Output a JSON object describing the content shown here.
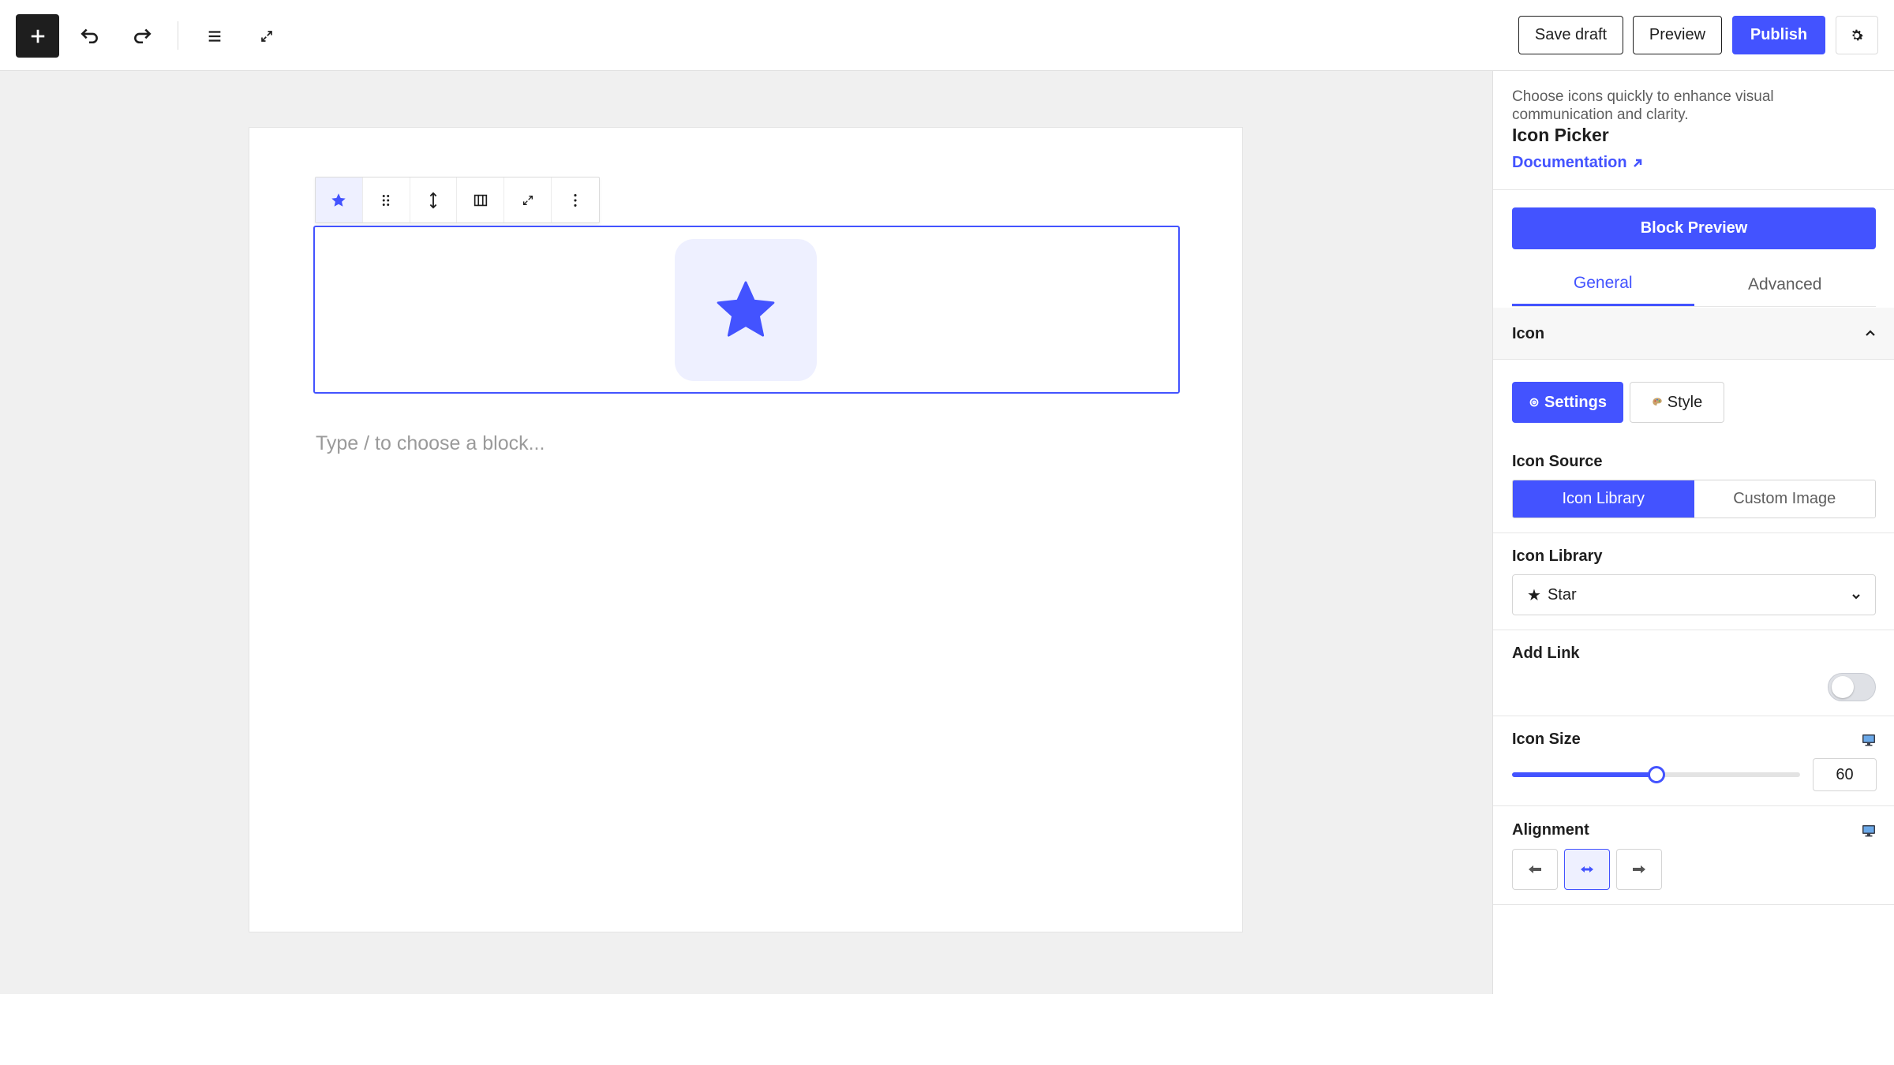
{
  "topbar": {
    "add_icon": "plus-icon",
    "undo_icon": "undo-icon",
    "redo_icon": "redo-icon",
    "list_view_icon": "list-view-icon",
    "fullscreen_icon": "expand-icon",
    "save_draft_label": "Save draft",
    "preview_label": "Preview",
    "publish_label": "Publish",
    "settings_icon": "gear-icon"
  },
  "editor": {
    "block_toolbar": [
      "star-icon",
      "drag-handle-icon",
      "move-icon",
      "align-icon",
      "expand-icon",
      "more-options-icon"
    ],
    "block_icon": "star-icon",
    "placeholder": "Type / to choose a block..."
  },
  "sidebar": {
    "description": "Choose icons quickly to enhance visual communication and clarity.",
    "block_title": "Icon Picker",
    "documentation_label": "Documentation",
    "block_preview_label": "Block Preview",
    "tabs": [
      {
        "label": "General",
        "active": true
      },
      {
        "label": "Advanced",
        "active": false
      }
    ],
    "panel_title": "Icon",
    "subtabs": {
      "settings_label": "Settings",
      "style_label": "Style"
    },
    "icon_source": {
      "label": "Icon Source",
      "options": [
        "Icon Library",
        "Custom Image"
      ],
      "selected": "Icon Library"
    },
    "icon_library": {
      "label": "Icon Library",
      "selected_glyph": "★",
      "selected": "Star"
    },
    "add_link": {
      "label": "Add Link",
      "enabled": false
    },
    "icon_size": {
      "label": "Icon Size",
      "value": "60",
      "slider_fraction": 0.5
    },
    "alignment": {
      "label": "Alignment",
      "options": [
        "left",
        "center",
        "right"
      ],
      "selected": "center"
    }
  },
  "colors": {
    "accent": "#4353ff",
    "accent_light": "#eef0ff",
    "canvas_bg": "#f0f0f0"
  }
}
